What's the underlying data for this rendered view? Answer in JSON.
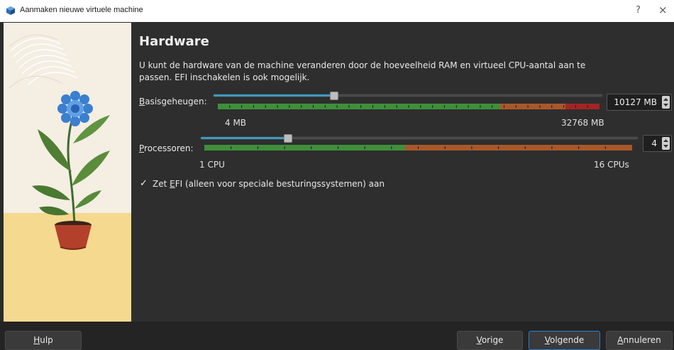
{
  "window": {
    "title": "Aanmaken nieuwe virtuele machine",
    "help": "?",
    "close": "×"
  },
  "page": {
    "heading": "Hardware",
    "description": "U kunt de hardware van de machine veranderen door de hoeveelheid RAM en virtueel CPU-aantal aan te passen. EFI inschakelen is ook mogelijk."
  },
  "memory": {
    "label_accel": "B",
    "label_rest": "asisgeheugen:",
    "value": "10127 MB",
    "min_label": "4 MB",
    "max_label": "32768 MB",
    "fraction": 0.31
  },
  "processors": {
    "label_accel": "P",
    "label_rest": "rocessoren:",
    "value": "4",
    "min_label": "1 CPU",
    "max_label": "16 CPUs",
    "fraction": 0.2
  },
  "efi": {
    "checked": true,
    "check_glyph": "✓",
    "label_pre": "Zet ",
    "label_accel": "E",
    "label_rest": "FI (alleen voor speciale besturingssystemen) aan"
  },
  "buttons": {
    "help_accel": "H",
    "help_rest": "ulp",
    "back_accel": "V",
    "back_rest": "orige",
    "next_accel": "V",
    "next_rest": "olgende",
    "cancel_accel": "A",
    "cancel_rest": "nnuleren"
  },
  "colors": {
    "good": "#3f8f3a",
    "warn": "#a8582a",
    "bad": "#a32525",
    "accent": "#3e9bc0"
  }
}
